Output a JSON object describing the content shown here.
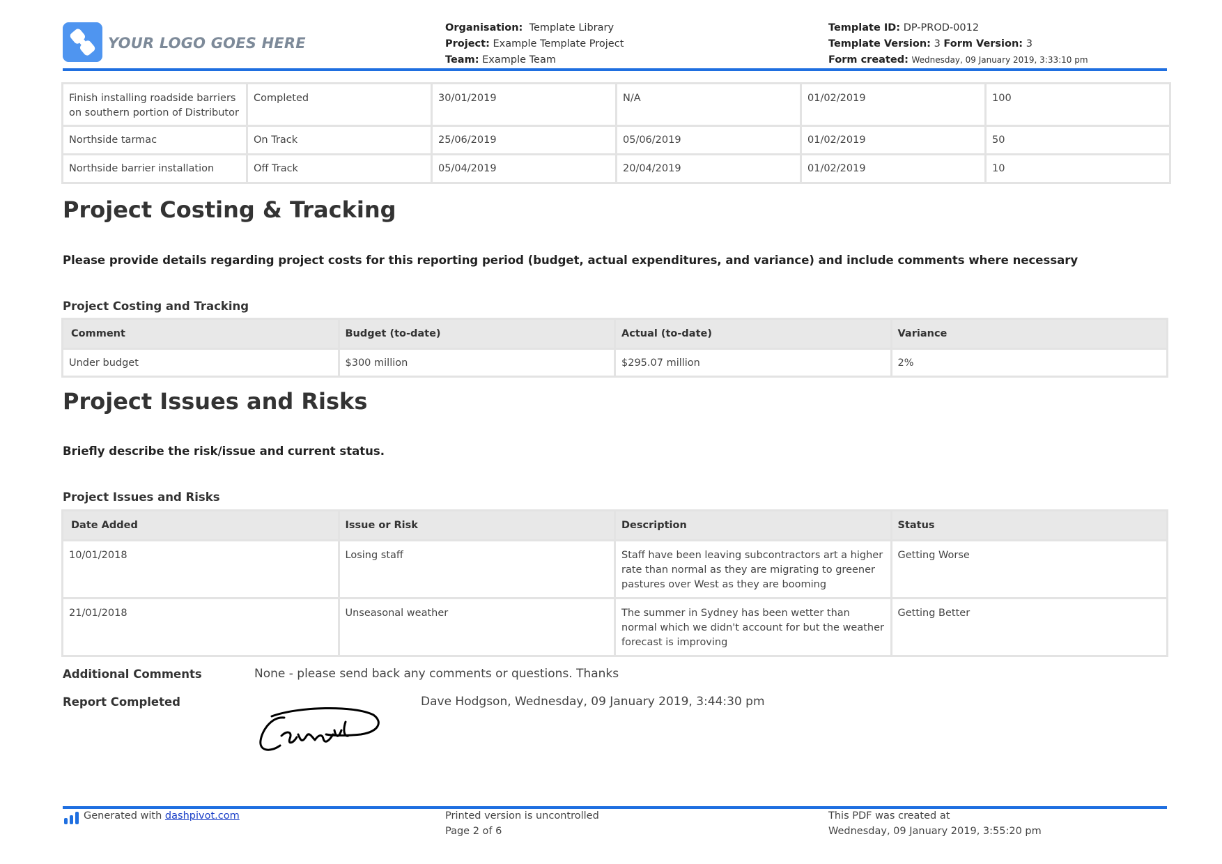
{
  "header": {
    "logo_text": "YOUR LOGO GOES HERE",
    "organisation_label": "Organisation:",
    "organisation_value": "Template Library",
    "project_label": "Project:",
    "project_value": "Example Template Project",
    "team_label": "Team:",
    "team_value": "Example Team",
    "template_id_label": "Template ID:",
    "template_id_value": "DP-PROD-0012",
    "template_version_label": "Template Version:",
    "template_version_value": "3",
    "form_version_label": "Form Version:",
    "form_version_value": "3",
    "form_created_label": "Form created:",
    "form_created_value": "Wednesday, 09 January 2019, 3:33:10 pm"
  },
  "milestones": {
    "rows": [
      [
        "Finish installing roadside barriers on southern portion of Distributor",
        "Completed",
        "30/01/2019",
        "N/A",
        "01/02/2019",
        "100"
      ],
      [
        "Northside tarmac",
        "On Track",
        "25/06/2019",
        "05/06/2019",
        "01/02/2019",
        "50"
      ],
      [
        "Northside barrier installation",
        "Off Track",
        "05/04/2019",
        "20/04/2019",
        "01/02/2019",
        "10"
      ]
    ]
  },
  "costing": {
    "heading": "Project Costing & Tracking",
    "instruction": "Please provide details regarding project costs for this reporting period (budget, actual expenditures, and variance) and include comments where necessary",
    "table_title": "Project Costing and Tracking",
    "columns": [
      "Comment",
      "Budget (to-date)",
      "Actual (to-date)",
      "Variance"
    ],
    "rows": [
      [
        "Under budget",
        "$300 million",
        "$295.07 million",
        "2%"
      ]
    ]
  },
  "risks": {
    "heading": "Project Issues and Risks",
    "instruction": "Briefly describe the risk/issue and current status.",
    "table_title": "Project Issues and Risks",
    "columns": [
      "Date Added",
      "Issue or Risk",
      "Description",
      "Status"
    ],
    "rows": [
      [
        "10/01/2018",
        "Losing staff",
        "Staff have been leaving subcontractors art a higher rate than normal as they are migrating to greener pastures over West as they are booming",
        "Getting Worse"
      ],
      [
        "21/01/2018",
        "Unseasonal weather",
        "The summer in Sydney has been wetter than normal which we didn't account for but the weather forecast is improving",
        "Getting Better"
      ]
    ]
  },
  "additional_comments": {
    "label": "Additional Comments",
    "value": "None - please send back any comments or questions. Thanks"
  },
  "report_completed": {
    "label": "Report Completed",
    "value": "Dave Hodgson, Wednesday, 09 January 2019, 3:44:30 pm"
  },
  "footer": {
    "generated_prefix": "Generated with",
    "generated_link": "dashpivot.com",
    "uncontrolled": "Printed version is uncontrolled",
    "page": "Page 2 of 6",
    "pdf_created_line1": "This PDF was created at",
    "pdf_created_line2": "Wednesday, 09 January 2019, 3:55:20 pm"
  },
  "colors": {
    "accent": "#1f6fe0",
    "logo": "#4f95f0",
    "table_border": "#e3e3e3",
    "table_header": "#e8e8e8"
  }
}
